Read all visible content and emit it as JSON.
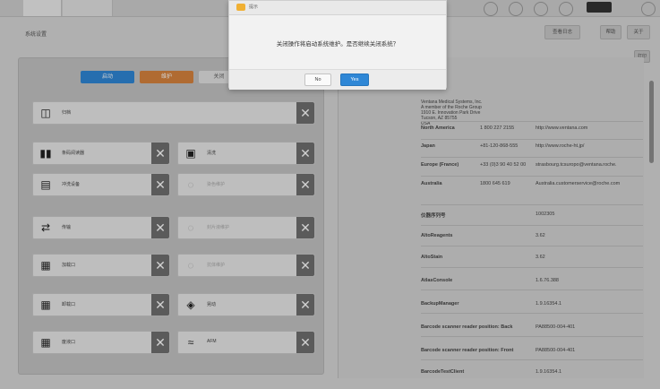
{
  "dialog": {
    "title": "提示",
    "message": "关闭操作将启动系统维护。是否继续关闭系统？",
    "no_label": "No",
    "yes_label": "Yes"
  },
  "page": {
    "title": "系统设置"
  },
  "action_buttons": [
    "启动",
    "维护",
    "关闭"
  ],
  "right_tabs": [
    "查看日志",
    "帮助",
    "关于"
  ],
  "right_extra_button": "打印",
  "tiles": [
    {
      "label": "归档",
      "icon": "rack-icon"
    },
    {
      "label": "条码阅读器",
      "icon": "barcode-icon"
    },
    {
      "label": "清洗",
      "icon": "wash-icon"
    },
    {
      "label": "冲洗设备",
      "icon": "flask-icon"
    },
    {
      "label": "染色维护",
      "icon": "stain-icon"
    },
    {
      "label": "传输",
      "icon": "transfer-icon"
    },
    {
      "label": "封片液维护",
      "icon": "stain2-icon"
    },
    {
      "label": "加载口",
      "icon": "port-icon"
    },
    {
      "label": "抗体维护",
      "icon": "stain3-icon"
    },
    {
      "label": "卸载口",
      "icon": "port2-icon"
    },
    {
      "label": "晃动",
      "icon": "layers-icon"
    },
    {
      "label": "废液口",
      "icon": "port3-icon"
    },
    {
      "label": "AFM",
      "icon": "waves-icon"
    }
  ],
  "company": {
    "name": "Ventana Medical Systems, Inc.",
    "group": "A member of the Roche Group",
    "address1": "1910 E. Innovation Park Drive",
    "address2": "Tucson, AZ 85755",
    "country": "USA"
  },
  "contacts": [
    {
      "region": "North America",
      "phone": "1 800 227 2155",
      "web": "http://www.ventana.com"
    },
    {
      "region": "Japan",
      "phone": "+81-120-868-555",
      "web": "http://www.roche-ht.jp/"
    },
    {
      "region": "Europe (France)",
      "phone": "+33 (0)3 90 40 52 00",
      "web": "strasbourg.tcsuropo@ventana.roche."
    },
    {
      "region": "Australia",
      "phone": "1800 645 619",
      "web": "Australia.customerservice@roche.com"
    }
  ],
  "versions": [
    {
      "name": "仪器序列号",
      "value": "1002305"
    },
    {
      "name": "AltoReagents",
      "value": "3.62"
    },
    {
      "name": "AltoStain",
      "value": "3.62"
    },
    {
      "name": "AtlasConsole",
      "value": "1.6.76.388"
    },
    {
      "name": "BackupManager",
      "value": "1.9.16354.1"
    },
    {
      "name": "Barcode scanner reader position: Back",
      "value": "PA88500-004-401"
    },
    {
      "name": "Barcode scanner reader position: Front",
      "value": "PA88500-004-401"
    },
    {
      "name": "BarcodeTestClient",
      "value": "1.9.16354.1"
    }
  ]
}
